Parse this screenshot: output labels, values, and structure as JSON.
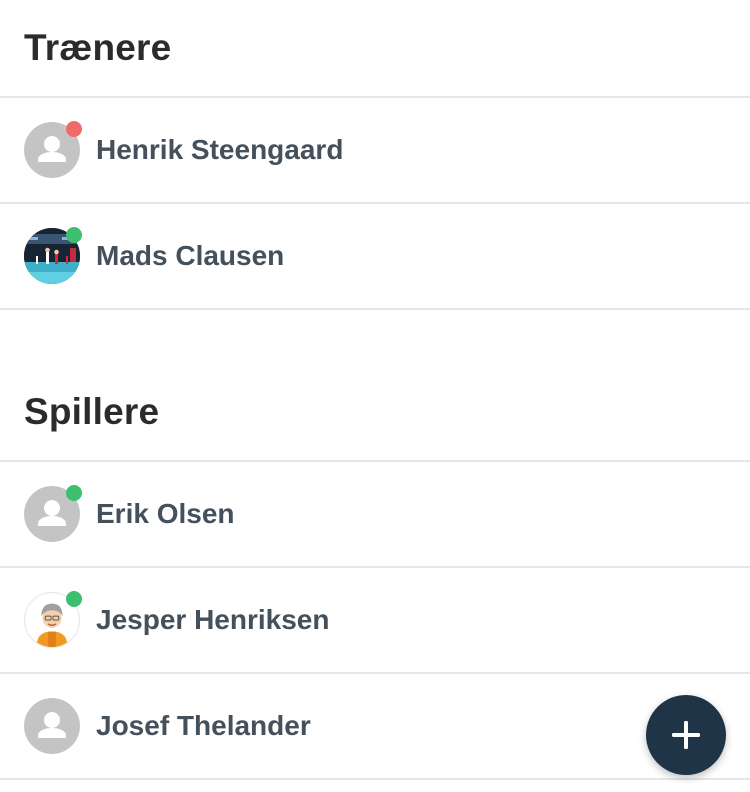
{
  "coaches": {
    "title": "Trænere",
    "members": [
      {
        "name": "Henrik Steengaard",
        "avatar": "default-person-icon",
        "status": "offline"
      },
      {
        "name": "Mads Clausen",
        "avatar": "photo-handball-arena",
        "status": "online"
      }
    ]
  },
  "players": {
    "title": "Spillere",
    "members": [
      {
        "name": "Erik Olsen",
        "avatar": "default-person-icon",
        "status": "online"
      },
      {
        "name": "Jesper Henriksen",
        "avatar": "cartoon-character",
        "status": "online"
      },
      {
        "name": "Josef Thelander",
        "avatar": "default-person-icon",
        "status": "none"
      }
    ]
  },
  "fab": {
    "icon": "plus-icon"
  },
  "colors": {
    "online": "#3cbf6e",
    "offline": "#f06a6a",
    "fab": "#1f3447",
    "name_text": "#44505b",
    "header_text": "#2b2b2b",
    "divider": "#e6e6e6",
    "avatar_placeholder": "#c4c4c4"
  }
}
